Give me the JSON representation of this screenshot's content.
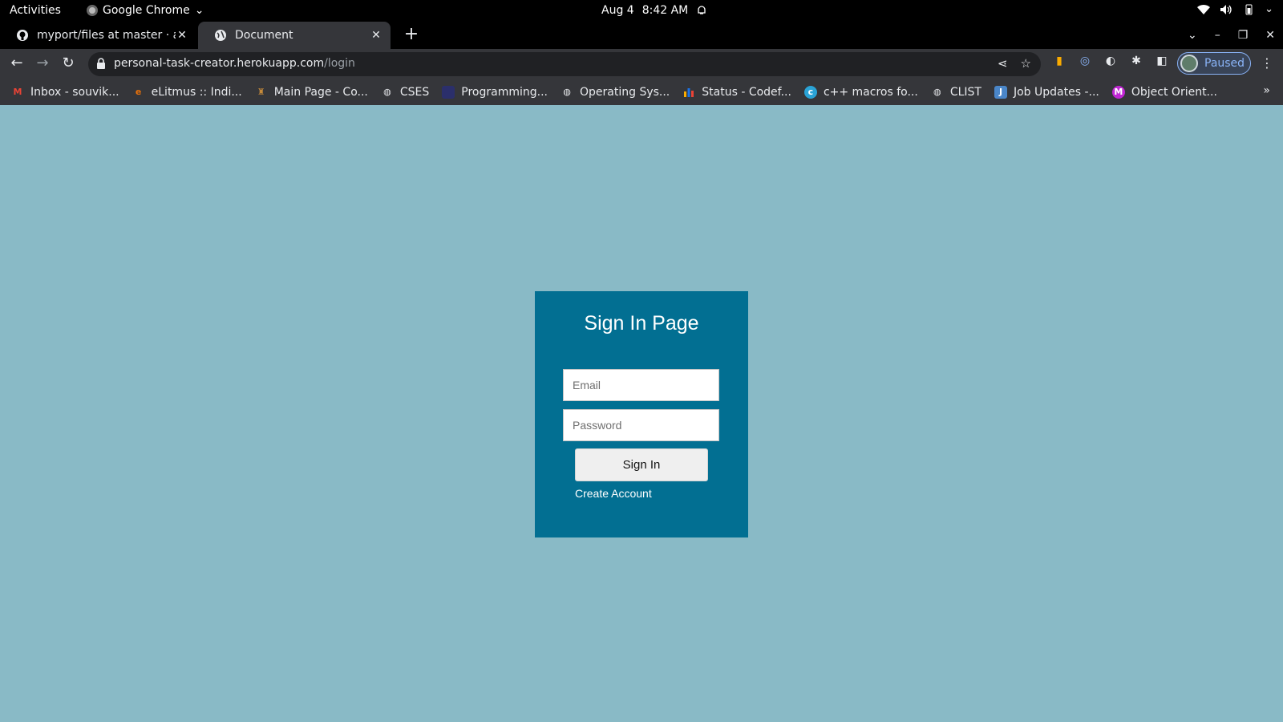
{
  "system": {
    "activities": "Activities",
    "app_name": "Google Chrome",
    "date": "Aug 4",
    "time": "8:42 AM"
  },
  "tabs": [
    {
      "title": "myport/files at master · al",
      "icon": "github-icon"
    },
    {
      "title": "Document",
      "icon": "globe-icon"
    }
  ],
  "toolbar": {
    "url_host": "personal-task-creator.herokuapp.com",
    "url_path": "/login",
    "profile_status": "Paused"
  },
  "bookmarks": [
    {
      "label": "Inbox - souvik...",
      "icon": "gmail-icon",
      "color": "#ea4335"
    },
    {
      "label": "eLitmus :: Indi...",
      "icon": "elitmus-icon",
      "color": "#e8710a"
    },
    {
      "label": "Main Page - Co...",
      "icon": "wiki-icon",
      "color": "#c58a3a"
    },
    {
      "label": "CSES",
      "icon": "globe-icon",
      "color": "#e8eaed"
    },
    {
      "label": "Programming...",
      "icon": "bookmark-icon",
      "color": "#3b3f8f"
    },
    {
      "label": "Operating Sys...",
      "icon": "globe-icon",
      "color": "#e8eaed"
    },
    {
      "label": "Status - Codef...",
      "icon": "codeforces-icon",
      "color": "#1a73e8"
    },
    {
      "label": "c++ macros fo...",
      "icon": "geeks-icon",
      "color": "#2aa3d6"
    },
    {
      "label": "CLIST",
      "icon": "globe-icon",
      "color": "#e8eaed"
    },
    {
      "label": "Job Updates -...",
      "icon": "job-icon",
      "color": "#4a86c8"
    },
    {
      "label": "Object Orient...",
      "icon": "m-icon",
      "color": "#c026d3"
    }
  ],
  "login": {
    "title": "Sign In Page",
    "email_placeholder": "Email",
    "password_placeholder": "Password",
    "signin_label": "Sign In",
    "create_account_label": "Create Account"
  },
  "colors": {
    "page_bg": "#89bac6",
    "card_bg": "#026f92"
  }
}
